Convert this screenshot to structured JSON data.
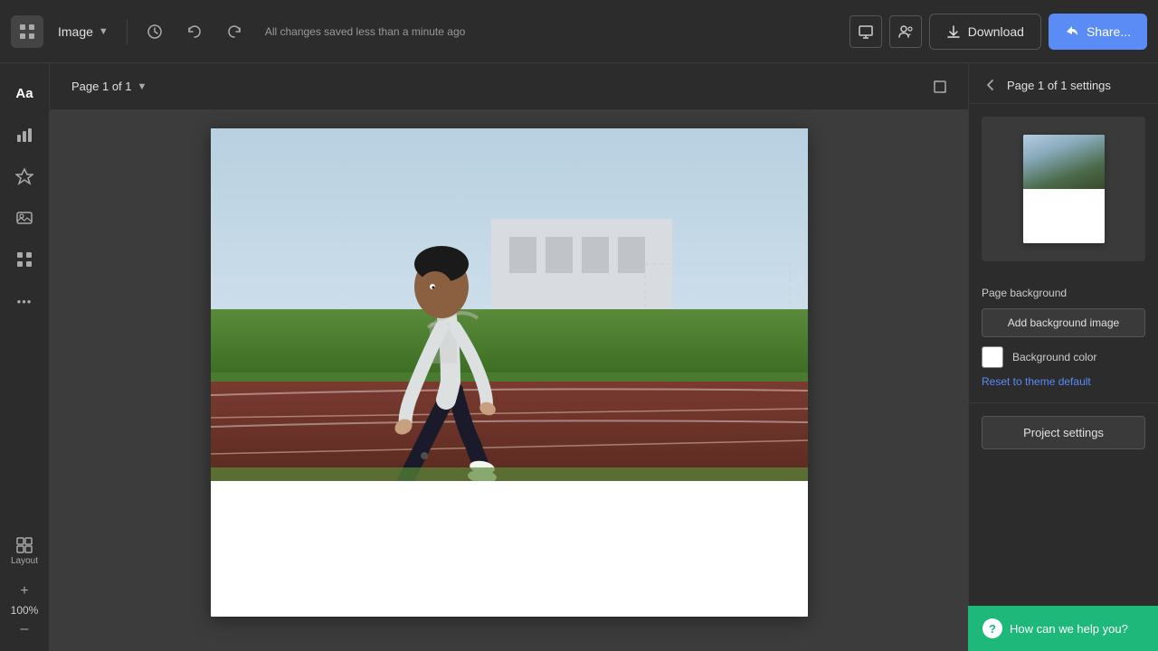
{
  "topbar": {
    "logo_icon": "grid-icon",
    "title": "Image",
    "autosave_message": "All changes saved less than a minute ago",
    "present_icon": "monitor-icon",
    "collab_icon": "users-icon",
    "download_icon": "download-icon",
    "download_label": "Download",
    "share_icon": "share-icon",
    "share_label": "Share..."
  },
  "left_sidebar": {
    "items": [
      {
        "id": "text",
        "icon": "Aa",
        "label": "Text"
      },
      {
        "id": "charts",
        "icon": "📊",
        "label": "Charts"
      },
      {
        "id": "elements",
        "icon": "⭐",
        "label": "Elements"
      },
      {
        "id": "photos",
        "icon": "🖼",
        "label": "Photos"
      },
      {
        "id": "apps",
        "icon": "🎨",
        "label": "Apps"
      },
      {
        "id": "more",
        "icon": "•••",
        "label": "More"
      }
    ],
    "bottom": {
      "layout_label": "Layout",
      "zoom_value": "100%",
      "zoom_plus": "+",
      "zoom_minus": "–"
    }
  },
  "canvas": {
    "page_label": "Page 1 of 1",
    "expand_icon": "expand-icon"
  },
  "right_panel": {
    "back_icon": "arrow-left-icon",
    "title": "Page 1 of 1 settings",
    "page_background_label": "Page background",
    "add_background_label": "Add background image",
    "background_color_label": "Background color",
    "reset_label": "Reset to theme default",
    "project_settings_label": "Project settings"
  },
  "help": {
    "icon": "?",
    "label": "How can we help you?"
  }
}
